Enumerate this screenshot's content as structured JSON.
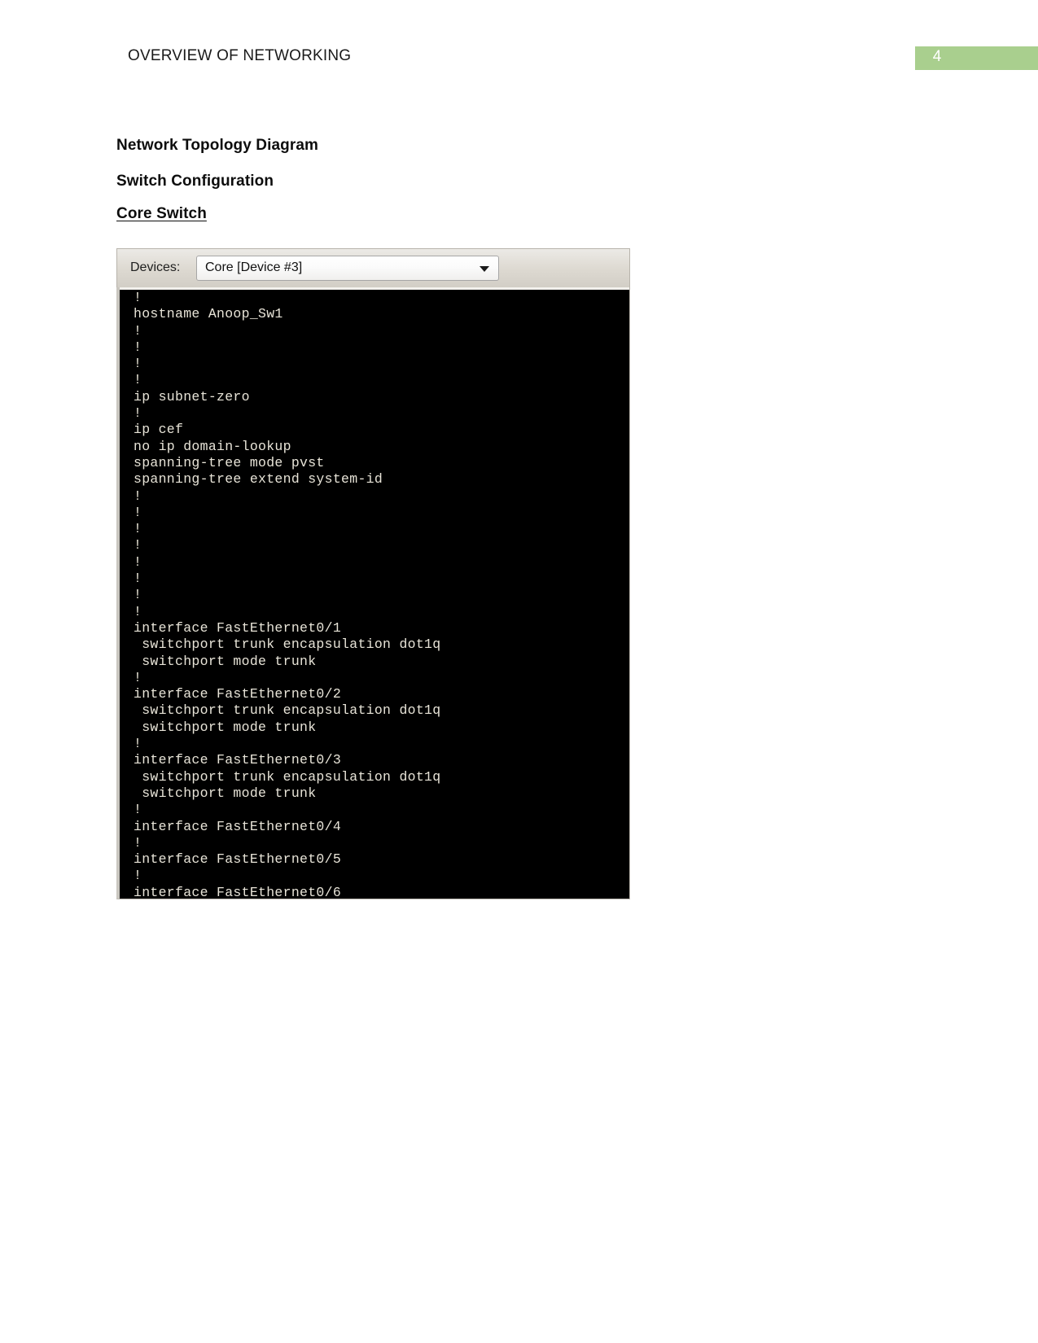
{
  "header": {
    "title": "OVERVIEW OF NETWORKING",
    "page_number": "4",
    "badge_color": "#a9cf8e"
  },
  "document": {
    "headings": [
      {
        "text": "Network Topology Diagram",
        "underlined": false
      },
      {
        "text": "Switch Configuration",
        "underlined": false
      },
      {
        "text": "Core Switch",
        "underlined": true
      }
    ]
  },
  "figure": {
    "devices_label": "Devices:",
    "device_selected": "Core [Device #3]",
    "dropdown_icon": "chevron-down-icon",
    "terminal_lines": [
      "!",
      "hostname Anoop_Sw1",
      "!",
      "!",
      "!",
      "!",
      "ip subnet-zero",
      "!",
      "ip cef",
      "no ip domain-lookup",
      "spanning-tree mode pvst",
      "spanning-tree extend system-id",
      "!",
      "!",
      "!",
      "!",
      "!",
      "!",
      "!",
      "!",
      "interface FastEthernet0/1",
      " switchport trunk encapsulation dot1q",
      " switchport mode trunk",
      "!",
      "interface FastEthernet0/2",
      " switchport trunk encapsulation dot1q",
      " switchport mode trunk",
      "!",
      "interface FastEthernet0/3",
      " switchport trunk encapsulation dot1q",
      " switchport mode trunk",
      "!",
      "interface FastEthernet0/4",
      "!",
      "interface FastEthernet0/5",
      "!",
      "interface FastEthernet0/6"
    ]
  }
}
